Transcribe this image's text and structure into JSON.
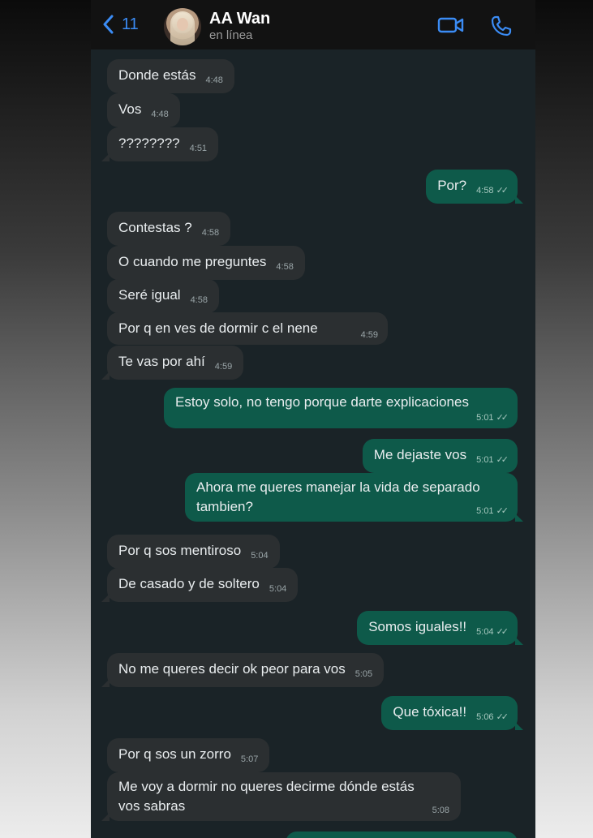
{
  "header": {
    "back_count": "11",
    "contact_name": "AA Wan",
    "contact_status": "en línea"
  },
  "messages": [
    {
      "dir": "in",
      "text": "Donde estás",
      "time": "4:48"
    },
    {
      "dir": "in",
      "text": "Vos",
      "time": "4:48"
    },
    {
      "dir": "in",
      "text": "????????",
      "time": "4:51"
    },
    {
      "dir": "out",
      "text": "Por?",
      "time": "4:58"
    },
    {
      "dir": "in",
      "text": "Contestas ?",
      "time": "4:58"
    },
    {
      "dir": "in",
      "text": "O cuando me preguntes",
      "time": "4:58"
    },
    {
      "dir": "in",
      "text": "Seré igual",
      "time": "4:58"
    },
    {
      "dir": "in",
      "text": "Por q en ves de dormir c el nene",
      "time": "4:59"
    },
    {
      "dir": "in",
      "text": "Te vas por ahí",
      "time": "4:59"
    },
    {
      "dir": "out",
      "text": "Estoy solo, no tengo porque darte explicaciones",
      "time": "5:01"
    },
    {
      "dir": "out",
      "text": "Me dejaste vos",
      "time": "5:01"
    },
    {
      "dir": "out",
      "text": "Ahora me queres manejar la vida de separado tambien?",
      "time": "5:01"
    },
    {
      "dir": "in",
      "text": "Por q sos mentiroso",
      "time": "5:04"
    },
    {
      "dir": "in",
      "text": "De casado y de soltero",
      "time": "5:04"
    },
    {
      "dir": "out",
      "text": "Somos iguales!!",
      "time": "5:04"
    },
    {
      "dir": "in",
      "text": "No me queres decir ok peor para vos",
      "time": "5:05"
    },
    {
      "dir": "out",
      "text": "Que tóxica!!",
      "time": "5:06"
    },
    {
      "dir": "in",
      "text": "Por q sos un zorro",
      "time": "5:07"
    },
    {
      "dir": "in",
      "text": "Me voy a dormir no queres decirme dónde estás vos sabras",
      "time": "5:08"
    }
  ],
  "read_receipt": "✓✓",
  "colors": {
    "accent": "#3b8cf5",
    "incoming_bubble": "#2b2f31",
    "outgoing_bubble": "#0e5a4a",
    "chat_background": "#1a2327",
    "header_background": "#121212"
  }
}
